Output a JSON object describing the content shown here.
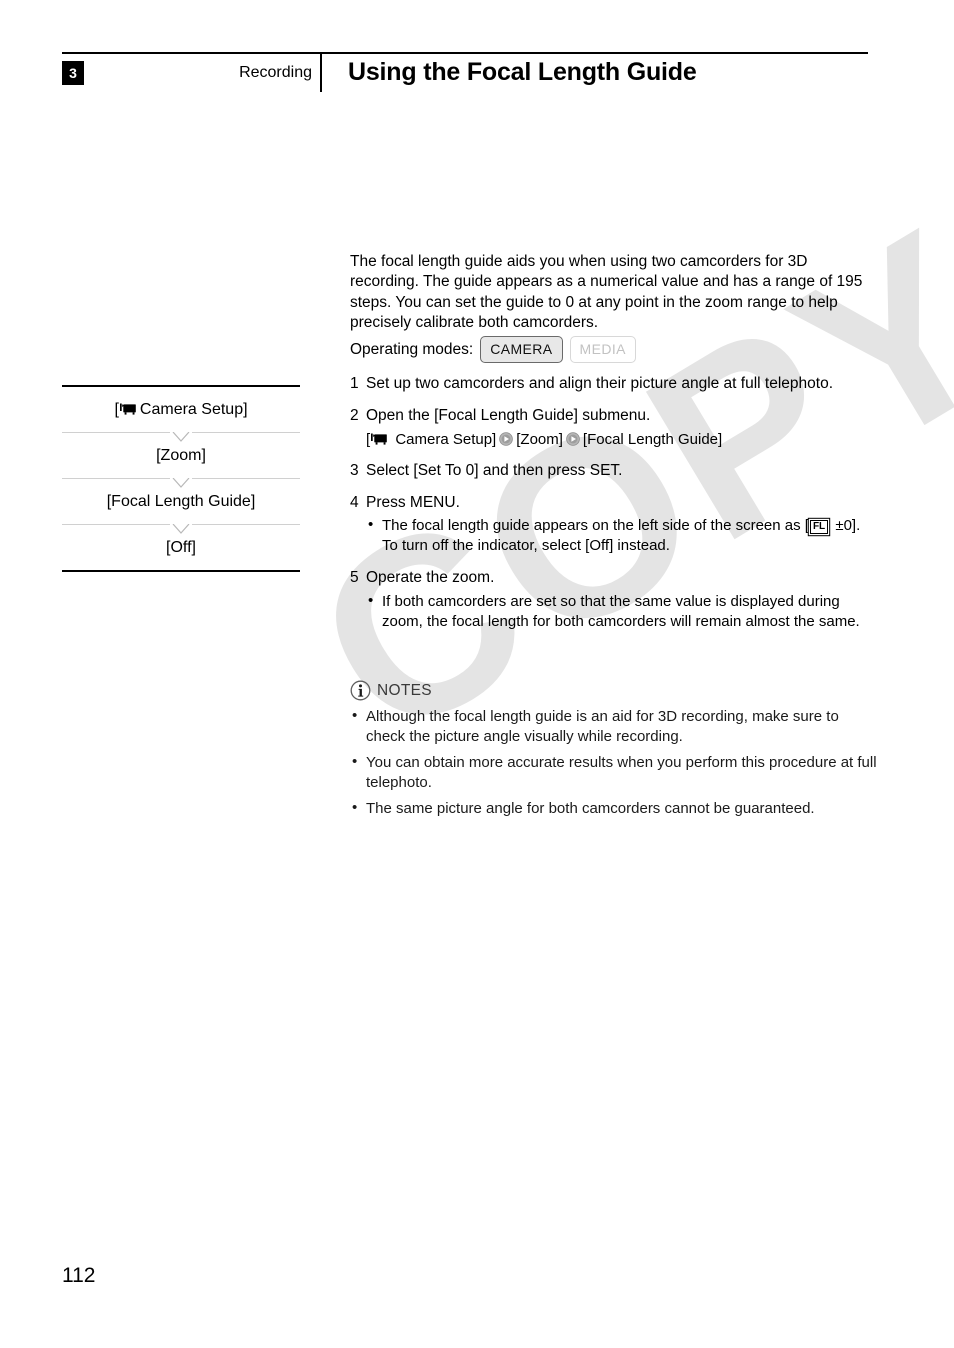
{
  "watermark": {
    "text": "COPY"
  },
  "header": {
    "chapter_number": "3",
    "section_label": "Recording",
    "title": "Using the Focal Length Guide"
  },
  "menu_flow": {
    "items": [
      {
        "label": "[",
        "icon": "camcorder-icon",
        "text": " Camera Setup]"
      },
      {
        "label": "[Zoom]"
      },
      {
        "label": "[Focal Length Guide]"
      },
      {
        "label": "[Off]"
      }
    ],
    "item_1_prefix": "[",
    "item_1_suffix": " Camera Setup]",
    "item_2": "[Zoom]",
    "item_3": "[Focal Length Guide]",
    "item_4": "[Off]"
  },
  "main": {
    "intro": "The focal length guide aids you when using two camcorders for 3D recording. The guide appears as a numerical value and has a range of 195 steps. You can set the guide to 0 at any point in the zoom range to help precisely calibrate both camcorders.",
    "operating_modes_label": "Operating modes:",
    "modes": [
      {
        "name": "CAMERA",
        "state": "active"
      },
      {
        "name": "MEDIA",
        "state": "inactive"
      }
    ],
    "mode_camera": "CAMERA",
    "mode_media": "MEDIA",
    "steps": [
      {
        "num": "1",
        "text": "Set up two camcorders and align their picture angle at full telephoto."
      },
      {
        "num": "2",
        "text": "Open the [Focal Length Guide] submenu.",
        "path_prefix": "[",
        "path_part1": " Camera Setup]",
        "path_part2": "[Zoom]",
        "path_part3": "[Focal Length Guide]"
      },
      {
        "num": "3",
        "text": "Select [Set To 0] and then press SET."
      },
      {
        "num": "4",
        "text": "Press MENU.",
        "bullet_a_part1": "The focal length guide appears on the left side of the screen as [",
        "bullet_a_badge": "FL",
        "bullet_a_part2": " ±0]. To turn off the indicator, select [Off] instead."
      },
      {
        "num": "5",
        "text": "Operate the zoom.",
        "bullet_a": "If both camcorders are set so that the same value is displayed during zoom, the focal length for both camcorders will remain almost the same."
      }
    ]
  },
  "notes": {
    "title": "NOTES",
    "items": [
      "Although the focal length guide is an aid for 3D recording, make sure to check the picture angle visually while recording.",
      "You can obtain more accurate results when you perform this procedure at full telephoto.",
      "The same picture angle for both camcorders cannot be guaranteed."
    ]
  },
  "footer": {
    "page_number": "112"
  },
  "colors": {
    "text": "#000000",
    "watermark": "#e4e4e4",
    "rule": "#000000",
    "separator": "#d0d0d0",
    "badge_active_bg": "#e8e8e8",
    "badge_inactive_text": "#c2c2c2"
  }
}
